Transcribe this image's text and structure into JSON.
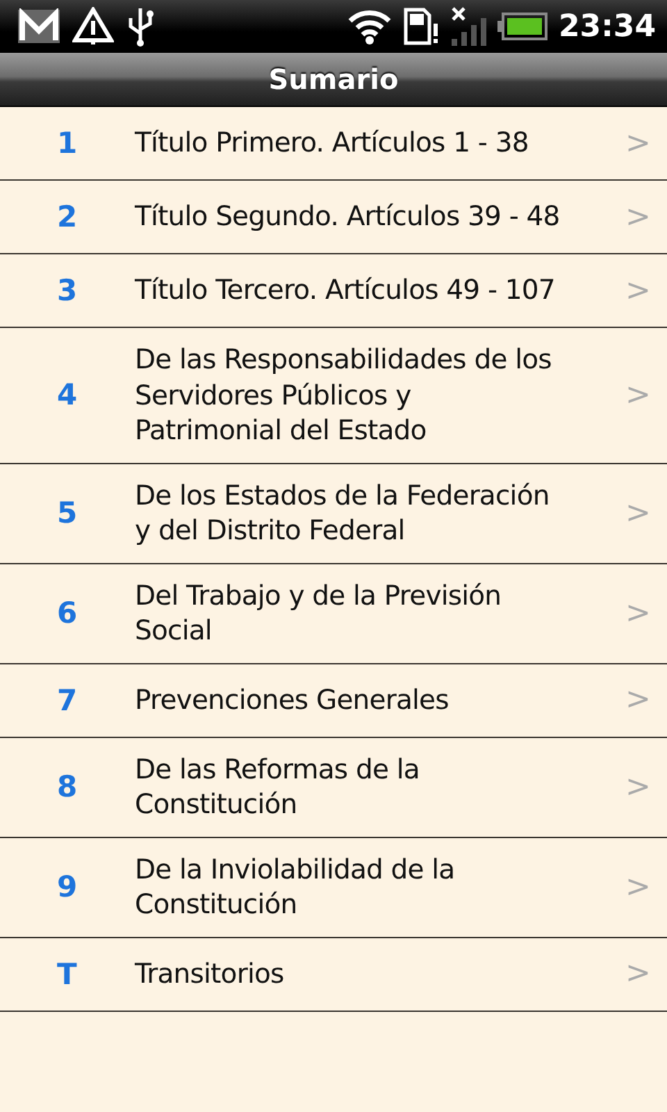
{
  "status_bar": {
    "time": "23:34"
  },
  "title": "Sumario",
  "items": [
    {
      "number": "1",
      "text": "Título Primero. Artículos 1 - 38",
      "chevron": ">"
    },
    {
      "number": "2",
      "text": "Título Segundo. Artículos 39 - 48",
      "chevron": ">"
    },
    {
      "number": "3",
      "text": "Título Tercero. Artículos 49 - 107",
      "chevron": ">"
    },
    {
      "number": "4",
      "text": "De las Responsabilidades de los\nServidores Públicos y\nPatrimonial del Estado",
      "chevron": ">"
    },
    {
      "number": "5",
      "text": "De los Estados de la Federación\ny del Distrito Federal",
      "chevron": ">"
    },
    {
      "number": "6",
      "text": "Del Trabajo y de la Previsión\nSocial",
      "chevron": ">"
    },
    {
      "number": "7",
      "text": "Prevenciones Generales",
      "chevron": ">"
    },
    {
      "number": "8",
      "text": "De las Reformas de la\nConstitución",
      "chevron": ">"
    },
    {
      "number": "9",
      "text": "De la Inviolabilidad de la\nConstitución",
      "chevron": ">"
    },
    {
      "number": "T",
      "text": "Transitorios",
      "chevron": ">"
    }
  ]
}
